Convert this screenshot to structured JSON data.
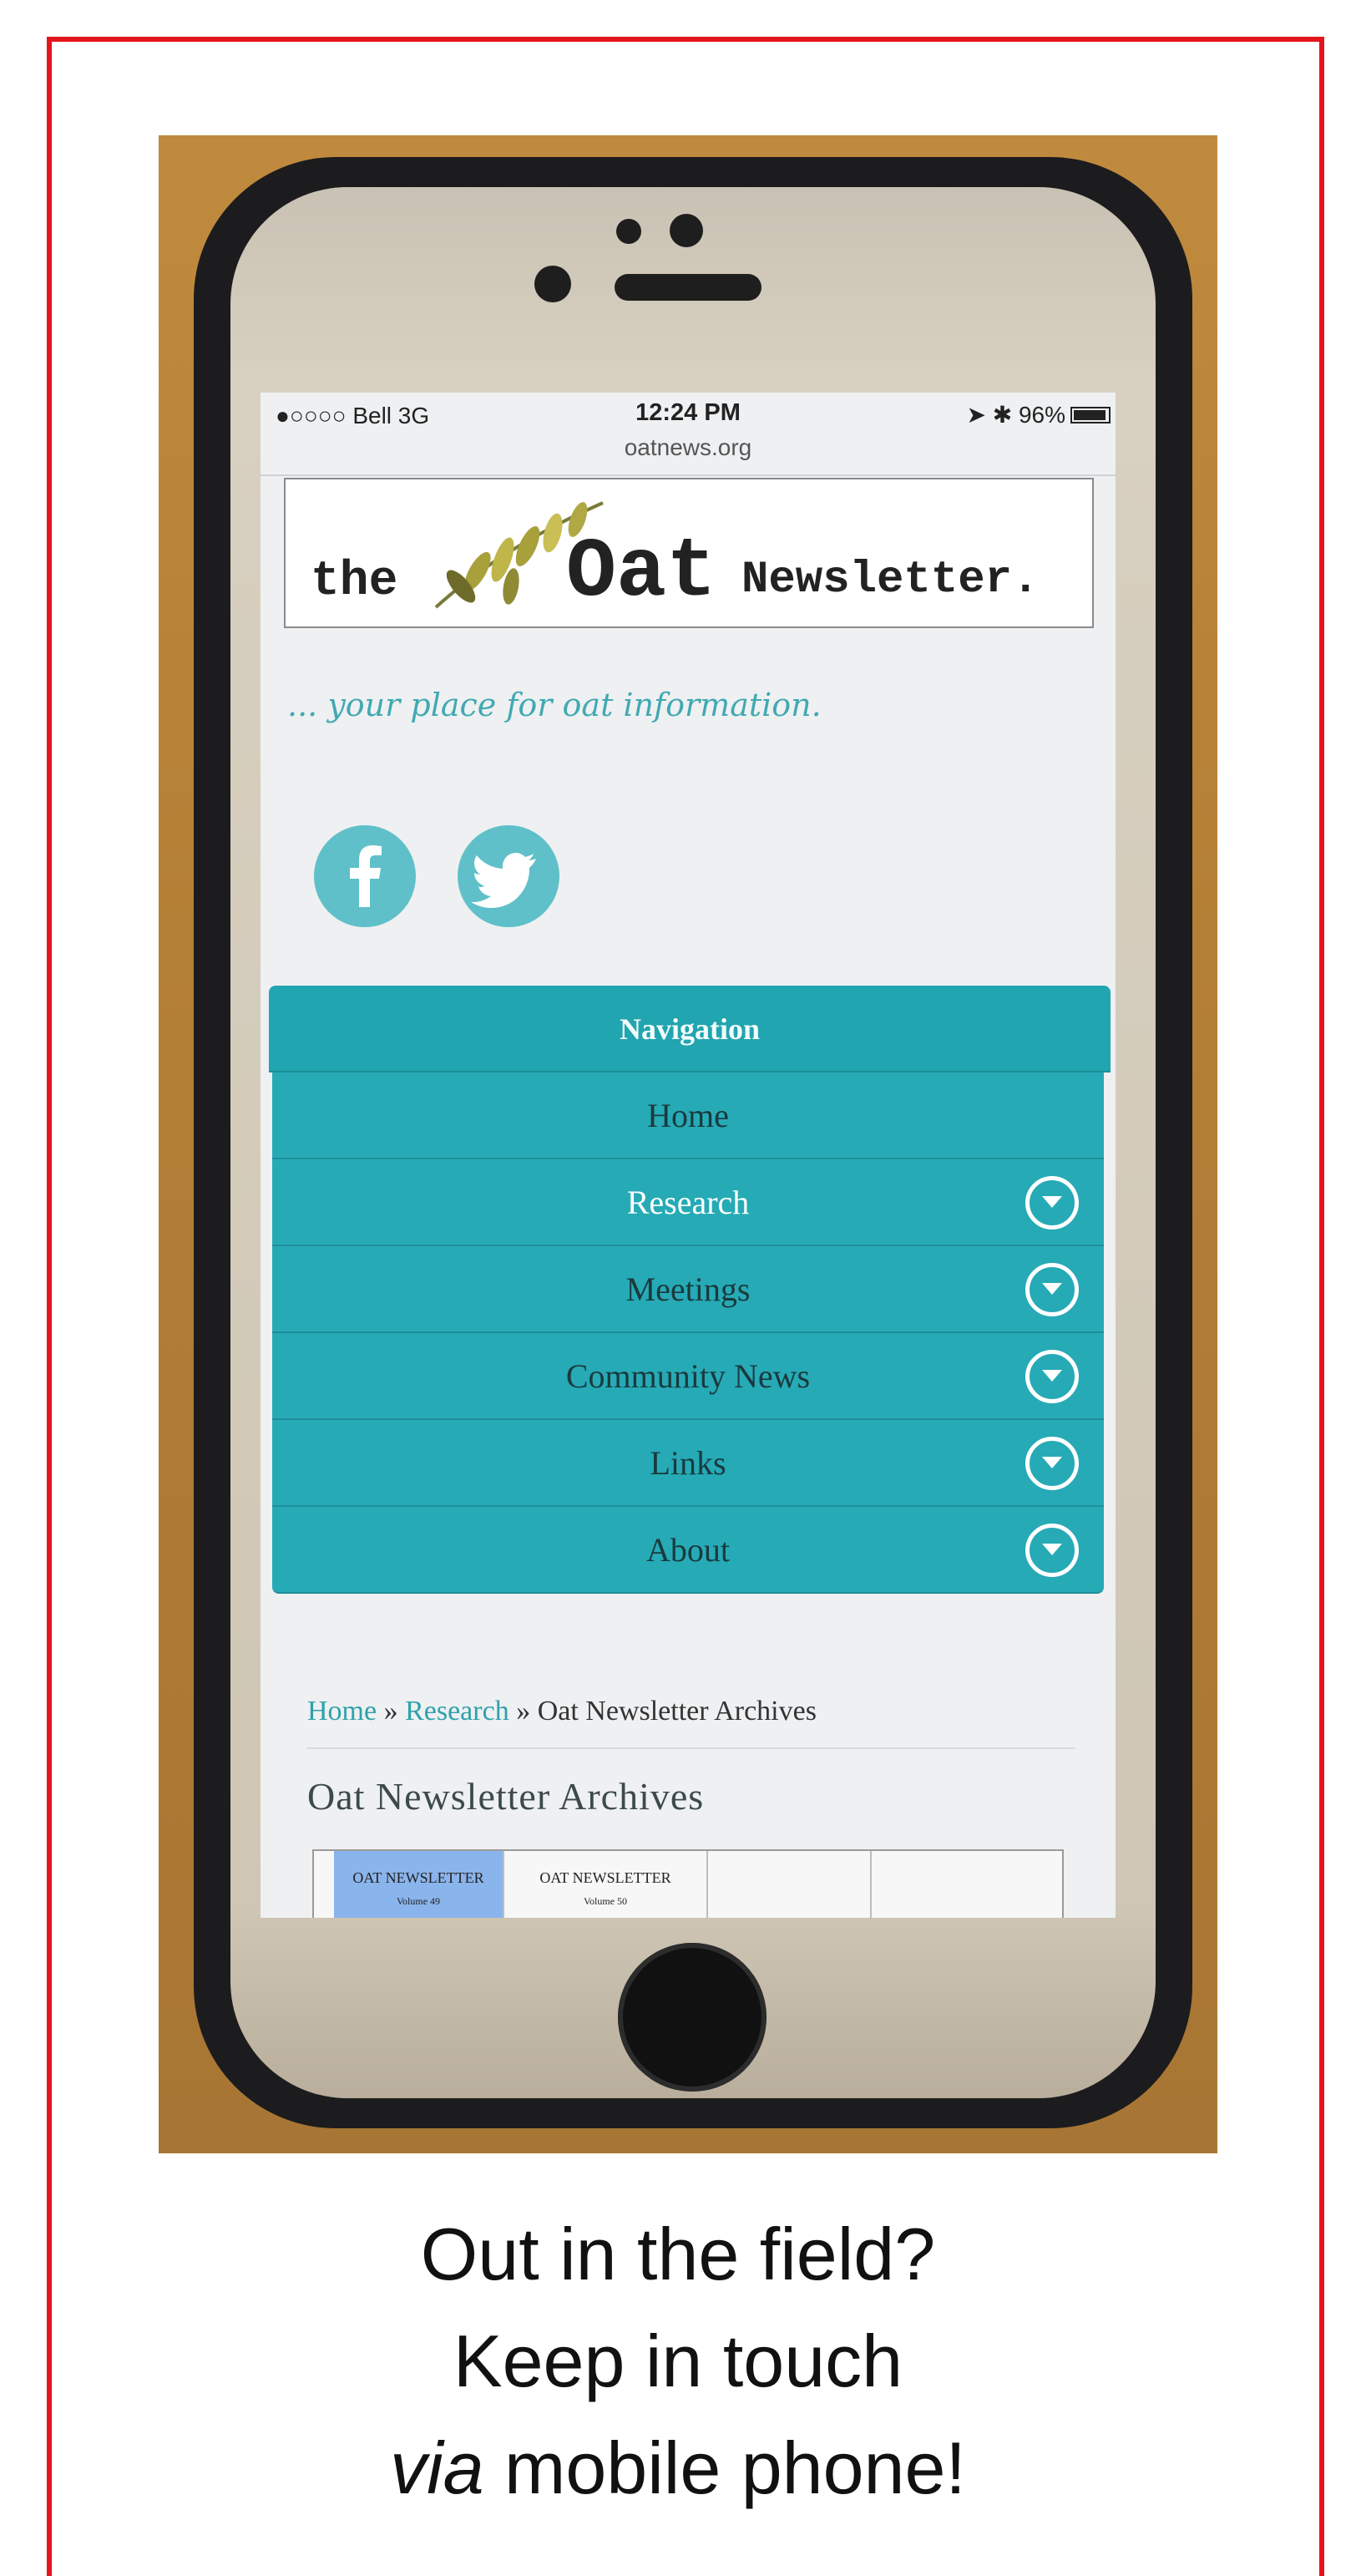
{
  "status_bar": {
    "carrier": "●○○○○ Bell   3G",
    "time": "12:24 PM",
    "battery": "96%",
    "url": "oatnews.org"
  },
  "site": {
    "logo_the": "the",
    "logo_oat": "Oat",
    "logo_newsletter": "Newsletter.",
    "tagline": "... your place for oat information."
  },
  "social": [
    {
      "icon": "facebook-icon"
    },
    {
      "icon": "twitter-icon"
    }
  ],
  "nav": {
    "header": "Navigation",
    "items": [
      {
        "label": "Home",
        "has_submenu": false
      },
      {
        "label": "Research",
        "has_submenu": true,
        "active": true
      },
      {
        "label": "Meetings",
        "has_submenu": true
      },
      {
        "label": "Community News",
        "has_submenu": true
      },
      {
        "label": "Links",
        "has_submenu": true
      },
      {
        "label": "About",
        "has_submenu": true
      }
    ]
  },
  "breadcrumb": {
    "home": "Home",
    "sep1": " » ",
    "research": "Research",
    "sep2": " » ",
    "current": "Oat Newsletter Archives"
  },
  "page": {
    "title": "Oat Newsletter Archives"
  },
  "archive": [
    {
      "title": "OAT NEWSLETTER",
      "volume": "Volume 49"
    },
    {
      "title": "OAT NEWSLETTER",
      "volume": "Volume 50"
    }
  ],
  "caption": {
    "line1": "Out in the field?",
    "line2": "Keep in touch",
    "line3_em": "via",
    "line3_rest": " mobile phone!"
  },
  "colors": {
    "nav_teal": "#26aab6",
    "accent_teal": "#2fa1ab",
    "frame_red": "#e4141b"
  }
}
